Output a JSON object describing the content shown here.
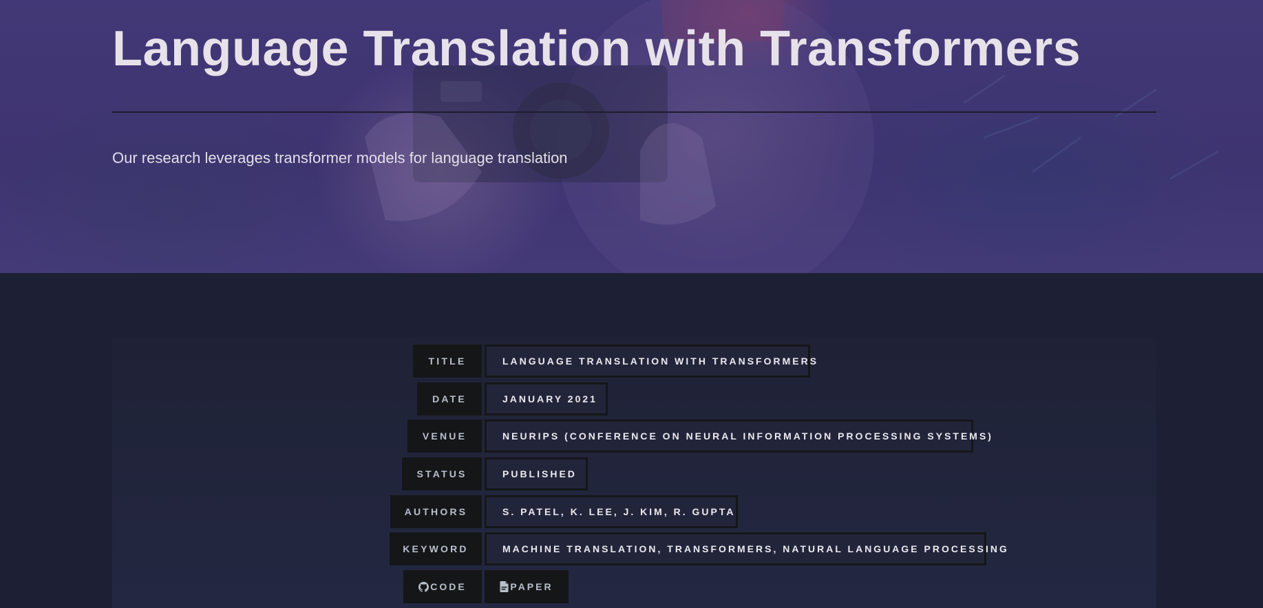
{
  "hero": {
    "title": "Language Translation with Transformers",
    "subtitle": "Our research leverages transformer models for language translation"
  },
  "meta": {
    "rows": [
      {
        "label": "TITLE",
        "value": "LANGUAGE TRANSLATION WITH TRANSFORMERS"
      },
      {
        "label": "DATE",
        "value": "JANUARY 2021"
      },
      {
        "label": "VENUE",
        "value": "NEURIPS (CONFERENCE ON NEURAL INFORMATION PROCESSING SYSTEMS)"
      },
      {
        "label": "STATUS",
        "value": "PUBLISHED"
      },
      {
        "label": "AUTHORS",
        "value": "S. PATEL, K. LEE, J. KIM, R. GUPTA"
      },
      {
        "label": "KEYWORD",
        "value": "MACHINE TRANSLATION, TRANSFORMERS, NATURAL LANGUAGE PROCESSING"
      }
    ],
    "links": {
      "code": {
        "label": "CODE",
        "icon": "github-icon"
      },
      "paper": {
        "label": "PAPER",
        "icon": "pdf-file-icon"
      }
    }
  },
  "colors": {
    "hero_overlay": "#3f3670",
    "page_bg": "#1d2035",
    "label_bg": "#151618",
    "value_bg": "#22253a"
  }
}
